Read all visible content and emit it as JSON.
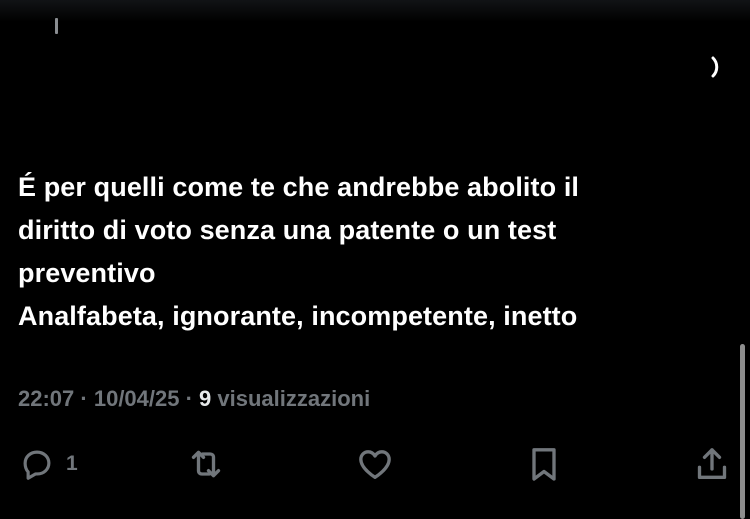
{
  "tweet": {
    "lines": [
      "É per quelli come te che andrebbe abolito il",
      "diritto di voto senza una patente o un test",
      "preventivo",
      "Analfabeta, ignorante, incompetente, inetto"
    ],
    "time": "22:07",
    "sep1": " · ",
    "date": "10/04/25",
    "sep2": " · ",
    "views_count": "9",
    "views_label": " visualizzazioni"
  },
  "actions": {
    "reply_count": "1",
    "icons": [
      "reply-icon",
      "retweet-icon",
      "like-icon",
      "bookmark-icon",
      "share-icon"
    ]
  },
  "colors": {
    "background": "#000000",
    "text": "#ffffff",
    "muted": "#71767b"
  }
}
